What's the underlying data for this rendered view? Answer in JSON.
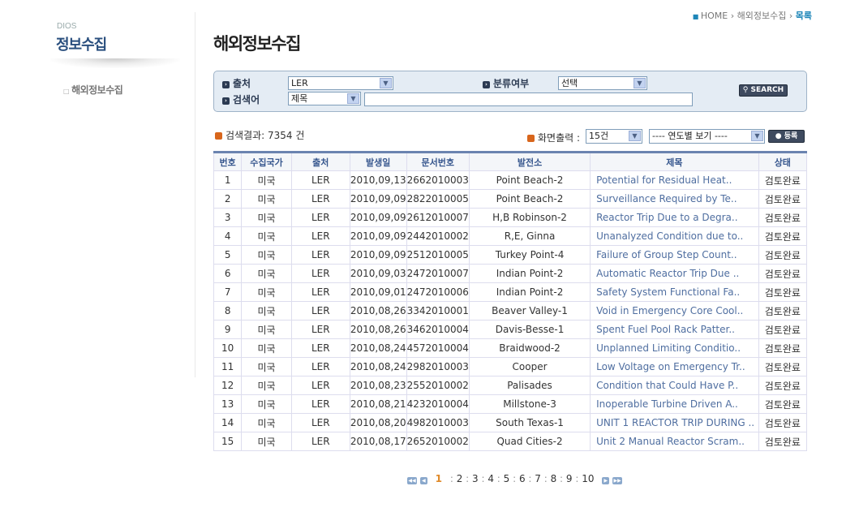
{
  "sidebar": {
    "sub": "DIOS",
    "title": "정보수집",
    "items": [
      {
        "label": "해외정보수집"
      }
    ]
  },
  "breadcrumb": {
    "home": "HOME",
    "section": "해외정보수집",
    "current": "목록"
  },
  "page_title": "해외정보수집",
  "search": {
    "source_label": "출처",
    "source_value": "LER",
    "class_label": "분류여부",
    "class_value": "선택",
    "keyword_label": "검색어",
    "keyword_field": "제목",
    "keyword_value": "",
    "search_button": "SEARCH"
  },
  "results": {
    "label": "검색결과: 7354 건",
    "display_label": "화면출력 :",
    "display_value": "15건",
    "year_value": "---- 연도별 보기 ----",
    "register_button": "등록"
  },
  "table": {
    "headers": [
      "번호",
      "수집국가",
      "출처",
      "발생일",
      "문서번호",
      "발전소",
      "제목",
      "상태"
    ],
    "rows": [
      [
        "1",
        "미국",
        "LER",
        "2010,09,13",
        "2662010003",
        "Point Beach-2",
        "Potential for Residual Heat..",
        "검토완료"
      ],
      [
        "2",
        "미국",
        "LER",
        "2010,09,09",
        "2822010005",
        "Point Beach-2",
        "Surveillance Required by Te..",
        "검토완료"
      ],
      [
        "3",
        "미국",
        "LER",
        "2010,09,09",
        "2612010007",
        "H,B Robinson-2",
        "Reactor Trip Due to a Degra..",
        "검토완료"
      ],
      [
        "4",
        "미국",
        "LER",
        "2010,09,09",
        "2442010002",
        "R,E, Ginna",
        "Unanalyzed Condition due to..",
        "검토완료"
      ],
      [
        "5",
        "미국",
        "LER",
        "2010,09,09",
        "2512010005",
        "Turkey Point-4",
        "Failure of Group Step Count..",
        "검토완료"
      ],
      [
        "6",
        "미국",
        "LER",
        "2010,09,03",
        "2472010007",
        "Indian Point-2",
        "Automatic Reactor Trip Due ..",
        "검토완료"
      ],
      [
        "7",
        "미국",
        "LER",
        "2010,09,01",
        "2472010006",
        "Indian Point-2",
        "Safety System Functional Fa..",
        "검토완료"
      ],
      [
        "8",
        "미국",
        "LER",
        "2010,08,26",
        "3342010001",
        "Beaver Valley-1",
        "Void in Emergency Core Cool..",
        "검토완료"
      ],
      [
        "9",
        "미국",
        "LER",
        "2010,08,26",
        "3462010004",
        "Davis-Besse-1",
        "Spent Fuel Pool Rack Patter..",
        "검토완료"
      ],
      [
        "10",
        "미국",
        "LER",
        "2010,08,24",
        "4572010004",
        "Braidwood-2",
        "Unplanned Limiting Conditio..",
        "검토완료"
      ],
      [
        "11",
        "미국",
        "LER",
        "2010,08,24",
        "2982010003",
        "Cooper",
        "Low Voltage on Emergency Tr..",
        "검토완료"
      ],
      [
        "12",
        "미국",
        "LER",
        "2010,08,23",
        "2552010002",
        "Palisades",
        "Condition that Could Have P..",
        "검토완료"
      ],
      [
        "13",
        "미국",
        "LER",
        "2010,08,21",
        "4232010004",
        "Millstone-3",
        "Inoperable Turbine Driven A..",
        "검토완료"
      ],
      [
        "14",
        "미국",
        "LER",
        "2010,08,20",
        "4982010003",
        "South Texas-1",
        "UNIT 1 REACTOR TRIP DURING ..",
        "검토완료"
      ],
      [
        "15",
        "미국",
        "LER",
        "2010,08,17",
        "2652010002",
        "Quad Cities-2",
        "Unit 2 Manual Reactor Scram..",
        "검토완료"
      ]
    ]
  },
  "pagination": {
    "current": "1",
    "pages": [
      "2",
      "3",
      "4",
      "5",
      "6",
      "7",
      "8",
      "9",
      "10"
    ]
  }
}
